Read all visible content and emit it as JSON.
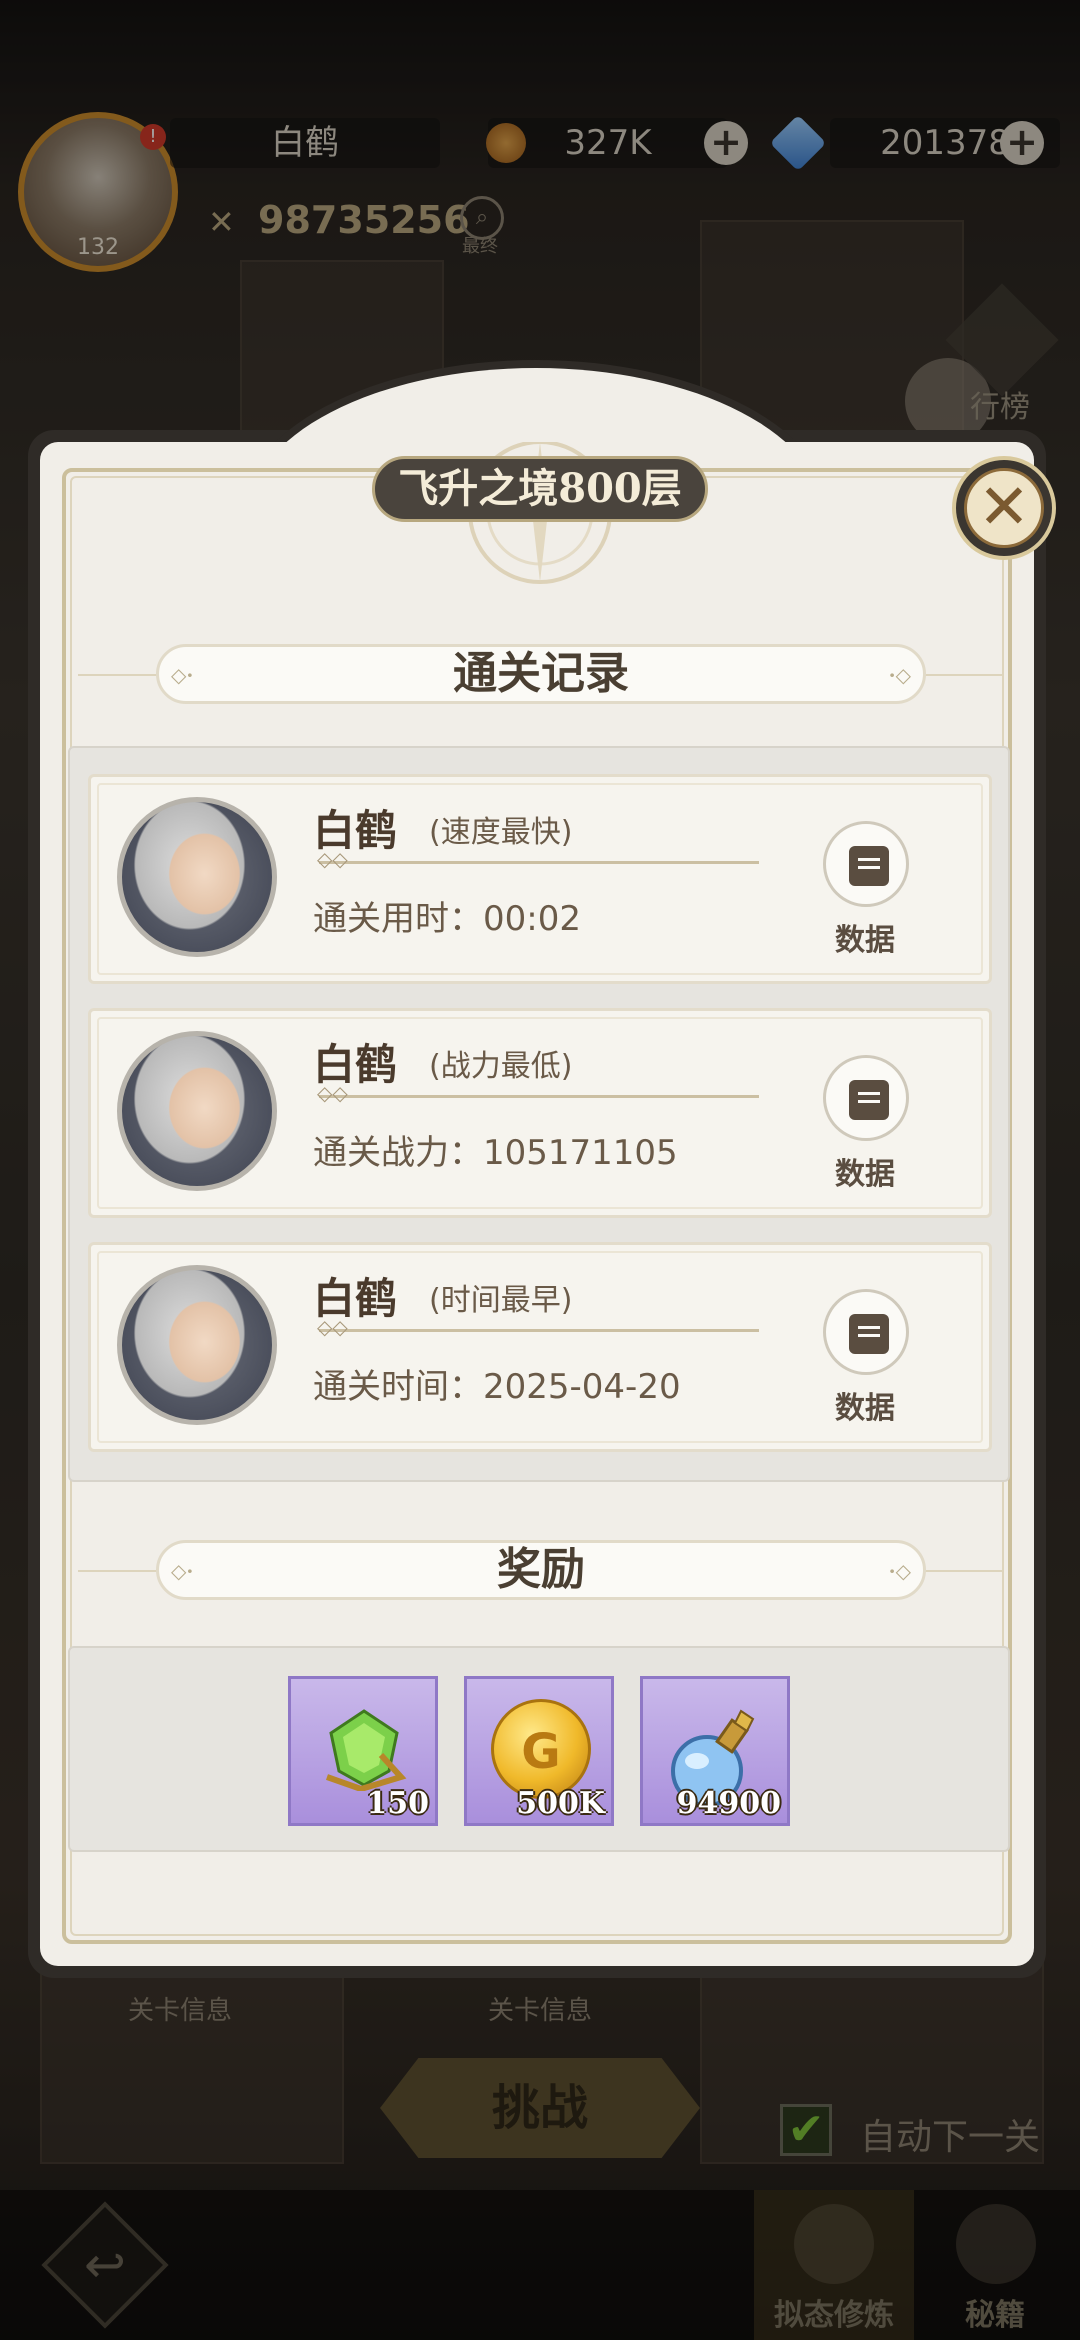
{
  "hud": {
    "player_name": "白鹤",
    "level": "132",
    "notification": "!",
    "coins": "327K",
    "gems": "201378",
    "combat_power": "98735256",
    "search_label": "最终",
    "plus": "+"
  },
  "side": {
    "rank_label": "行榜"
  },
  "modal": {
    "title": "飞升之境800层",
    "close_glyph": "✕",
    "records_heading": "通关记录",
    "rewards_heading": "奖励",
    "records": [
      {
        "name": "白鹤",
        "tag": "(速度最快)",
        "stat": "通关用时：00:02",
        "data_label": "数据"
      },
      {
        "name": "白鹤",
        "tag": "(战力最低)",
        "stat": "通关战力：105171105",
        "data_label": "数据"
      },
      {
        "name": "白鹤",
        "tag": "(时间最早)",
        "stat": "通关时间：2025-04-20",
        "data_label": "数据"
      }
    ],
    "rewards": [
      {
        "icon": "green-gem-icon",
        "count": "150"
      },
      {
        "icon": "gold-coin-icon",
        "count": "500K"
      },
      {
        "icon": "blue-potion-icon",
        "count": "94900"
      }
    ]
  },
  "background": {
    "stage_info_left": "关卡信息",
    "stage_info_right": "关卡信息",
    "challenge_button": "挑战",
    "auto_next_label": "自动下一关",
    "auto_next_checked": "✔",
    "back_glyph": "↩",
    "tab_simulate": "拟态修炼",
    "tab_secret": "秘籍"
  },
  "colors": {
    "accent_gold": "#c98a2b",
    "modal_bg": "#f1eee8",
    "reward_purple": "#a98fdc"
  }
}
